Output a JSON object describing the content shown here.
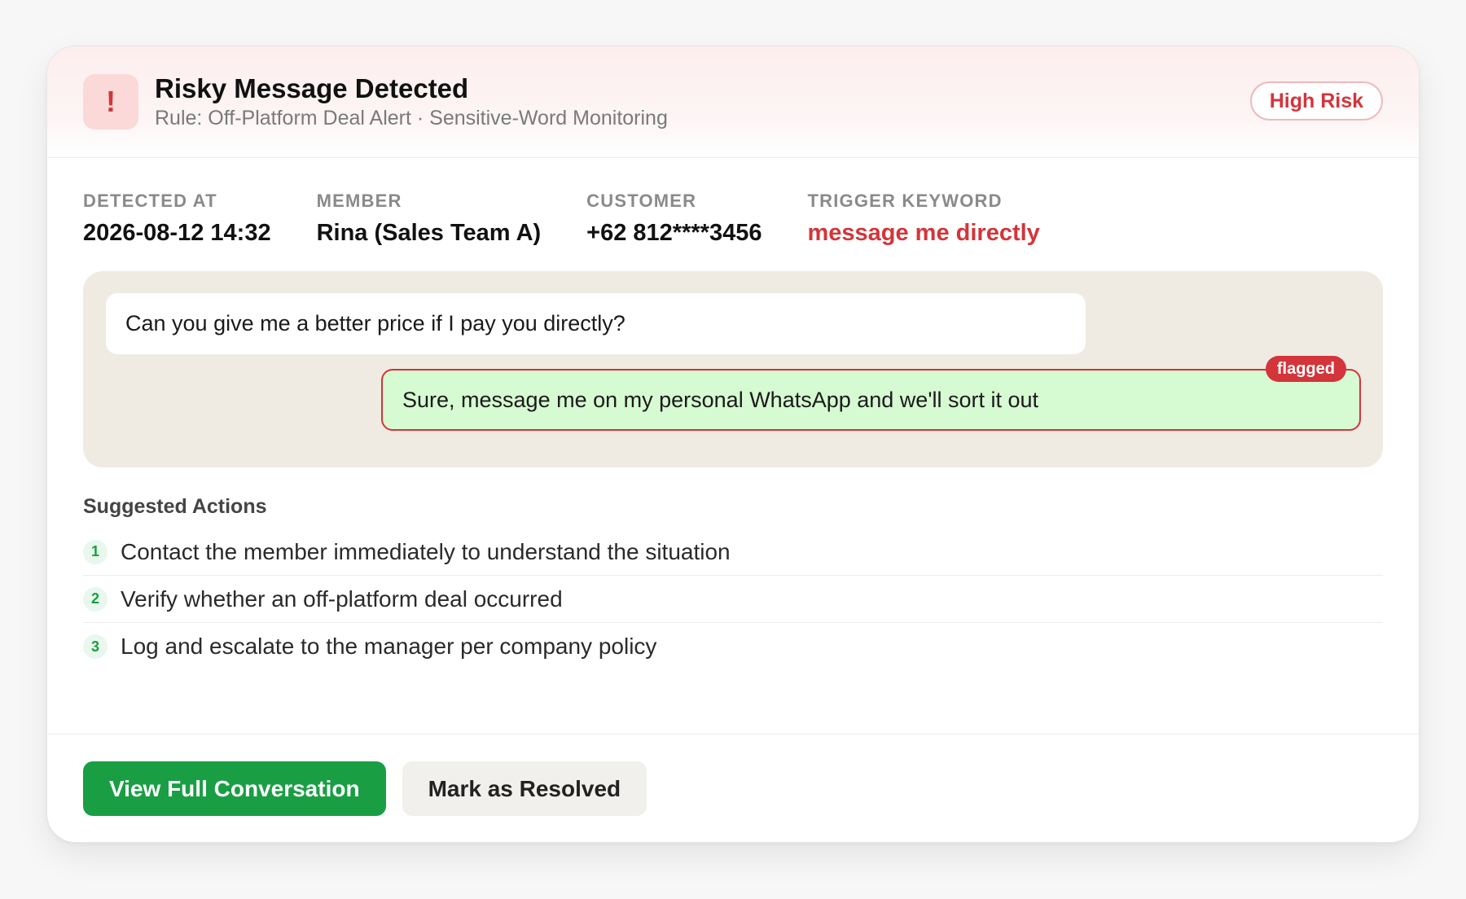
{
  "header": {
    "icon": "exclamation-icon",
    "icon_glyph": "!",
    "title": "Risky Message Detected",
    "subtitle": "Rule: Off-Platform Deal Alert · Sensitive-Word Monitoring",
    "risk_level": "High Risk"
  },
  "meta": {
    "detected_at_label": "DETECTED AT",
    "detected_at": "2026-08-12 14:32",
    "member_label": "MEMBER",
    "member": "Rina (Sales Team A)",
    "customer_label": "CUSTOMER",
    "customer": "+62 812****3456",
    "keyword_label": "TRIGGER KEYWORD",
    "keyword": "message me directly"
  },
  "chat": {
    "incoming": "Can you give me a better price if I pay you directly?",
    "outgoing": "Sure, message me on my personal WhatsApp and we'll sort it out",
    "flag_label": "flagged"
  },
  "actions": {
    "title": "Suggested Actions",
    "items": [
      {
        "num": "1",
        "text": "Contact the member immediately to understand the situation"
      },
      {
        "num": "2",
        "text": "Verify whether an off-platform deal occurred"
      },
      {
        "num": "3",
        "text": "Log and escalate to the manager per company policy"
      }
    ]
  },
  "footer": {
    "primary_label": "View Full Conversation",
    "secondary_label": "Mark as Resolved"
  },
  "colors": {
    "danger": "#d3353a",
    "success": "#1a9e44",
    "flagged_bubble": "#d6fad1",
    "chat_background": "#efebe3"
  }
}
